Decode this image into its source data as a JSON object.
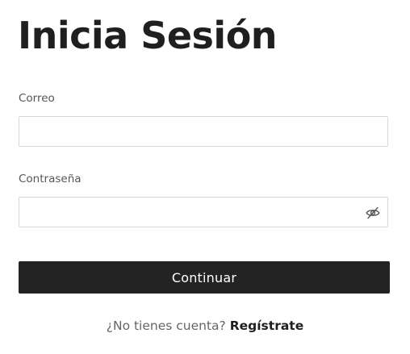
{
  "heading": "Inicia Sesión",
  "email": {
    "label": "Correo",
    "value": "",
    "placeholder": ""
  },
  "password": {
    "label": "Contraseña",
    "value": "",
    "placeholder": "",
    "toggle_icon": "eye-slash-icon"
  },
  "continue_label": "Continuar",
  "signup": {
    "question": "¿No tienes cuenta?",
    "link_label": "Regístrate"
  },
  "colors": {
    "button_bg": "#232323",
    "button_text": "#ffffff",
    "input_border": "#d8d8d8",
    "label_text": "#555555",
    "heading_text": "#1f1f1f"
  }
}
